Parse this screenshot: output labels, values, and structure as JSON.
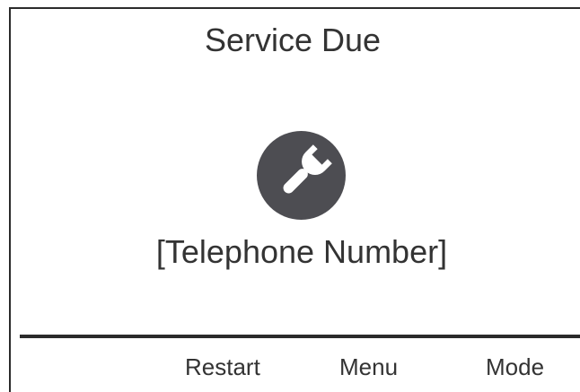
{
  "screen": {
    "title": "Service Due",
    "icon": "wrench-icon",
    "phone_placeholder": "[Telephone Number]"
  },
  "softkeys": {
    "restart": "Restart",
    "menu": "Menu",
    "mode": "Mode"
  },
  "colors": {
    "icon_fill": "#4d4d52",
    "text": "#333333",
    "rule": "#2b2b2b"
  }
}
